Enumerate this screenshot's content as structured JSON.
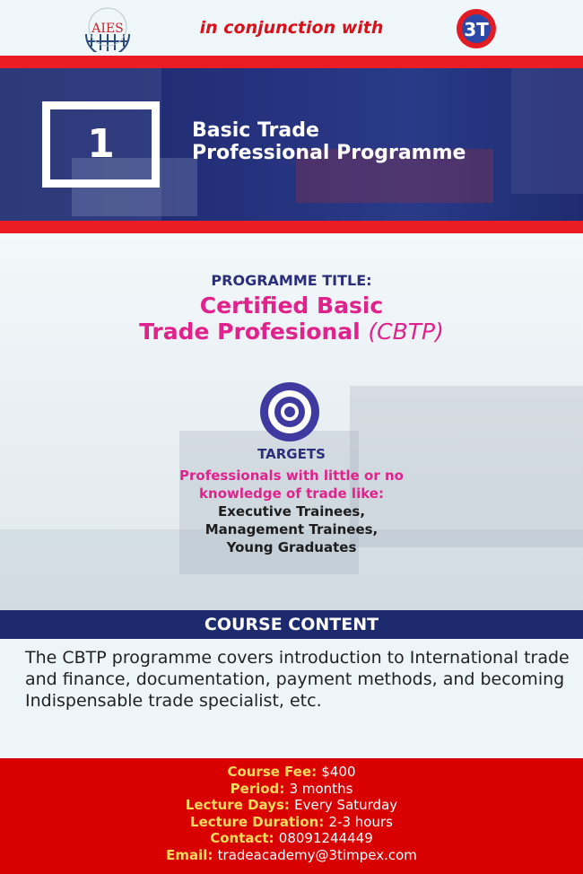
{
  "header": {
    "logo_left": "AIES",
    "conjunction": "in conjunction with",
    "logo_right": "3T"
  },
  "banner": {
    "number": "1",
    "title_line1": "Basic Trade",
    "title_line2": "Professional Programme"
  },
  "programme": {
    "label": "PROGRAMME TITLE:",
    "title_line1": "Certified Basic",
    "title_line2": "Trade Profesional",
    "abbr": "(CBTP)"
  },
  "targets": {
    "heading": "TARGETS",
    "pink_line1": "Professionals with little or no",
    "pink_line2": "knowledge of trade like:",
    "items": [
      "Executive Trainees,",
      "Management Trainees,",
      "Young Graduates"
    ]
  },
  "course": {
    "heading": "COURSE CONTENT",
    "description": "The CBTP programme covers introduction to International trade and finance, documentation, payment methods, and becoming Indispensable trade specialist, etc."
  },
  "info": [
    {
      "label": "Course Fee:",
      "value": "$400"
    },
    {
      "label": "Period:",
      "value": "3 months"
    },
    {
      "label": "Lecture Days:",
      "value": "Every Saturday"
    },
    {
      "label": "Lecture Duration:",
      "value": "2-3 hours"
    },
    {
      "label": "Contact:",
      "value": "08091244449"
    },
    {
      "label": "Email:",
      "value": "tradeacademy@3timpex.com"
    }
  ],
  "colors": {
    "red": "#ec1c24",
    "navy": "#1e2a6e",
    "magenta": "#e0238c",
    "gold": "#fddc5c"
  }
}
